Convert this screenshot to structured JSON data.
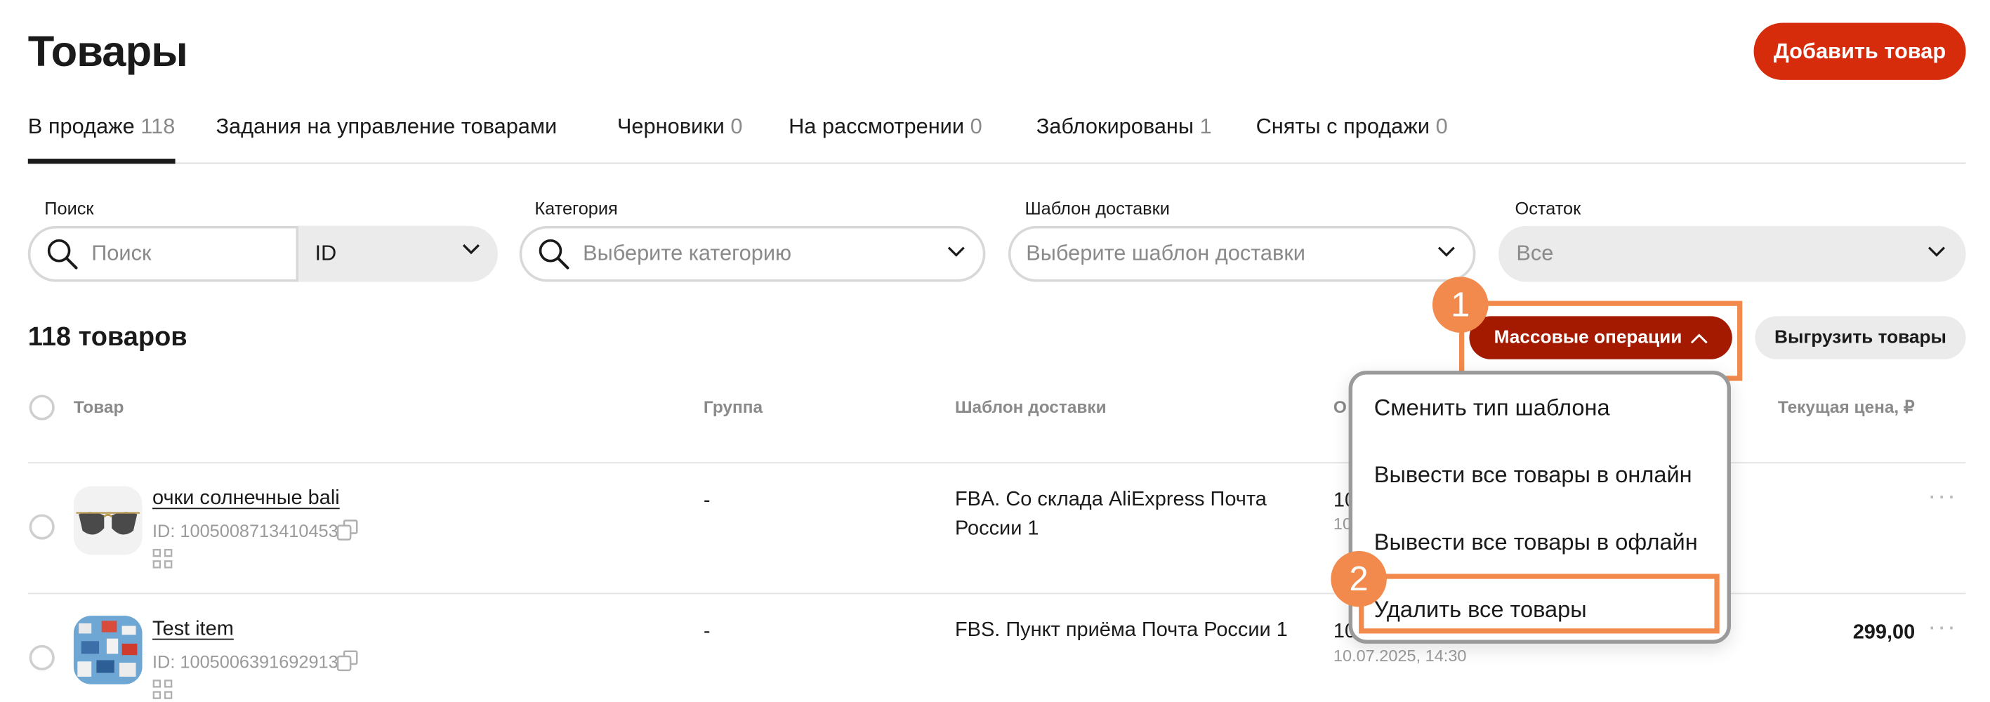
{
  "page": {
    "title": "Товары",
    "add_button": "Добавить товар"
  },
  "tabs": [
    {
      "label": "В продаже",
      "count": "118"
    },
    {
      "label": "Задания на управление товарами",
      "count": ""
    },
    {
      "label": "Черновики",
      "count": "0"
    },
    {
      "label": "На рассмотрении",
      "count": "0"
    },
    {
      "label": "Заблокированы",
      "count": "1"
    },
    {
      "label": "Сняты с продажи",
      "count": "0"
    }
  ],
  "filters": {
    "search": {
      "label": "Поиск",
      "placeholder": "Поиск",
      "type_value": "ID"
    },
    "category": {
      "label": "Категория",
      "placeholder": "Выберите категорию"
    },
    "delivery": {
      "label": "Шаблон доставки",
      "placeholder": "Выберите шаблон доставки"
    },
    "stock": {
      "label": "Остаток",
      "value": "Все"
    }
  },
  "summary": {
    "count_text": "118 товаров"
  },
  "toolbar": {
    "mass_ops": "Массовые операции",
    "export": "Выгрузить товары"
  },
  "table": {
    "headers": {
      "product": "Товар",
      "group": "Группа",
      "delivery": "Шаблон доставки",
      "stock_partial": "О",
      "price": "Текущая цена, ₽"
    },
    "rows": [
      {
        "name": "очки солнечные bali",
        "id": "ID: 1005008713410453",
        "group": "-",
        "delivery": "FBA. Со склада AliExpress Почта России 1",
        "stock_partial": "10",
        "date_partial": "10",
        "price": ""
      },
      {
        "name": "Test item",
        "id": "ID: 1005006391692913",
        "group": "-",
        "delivery": "FBS. Пункт приёма Почта России 1",
        "stock_partial": "10",
        "date": "10.07.2025, 14:30",
        "price": "299,00"
      }
    ]
  },
  "menu": {
    "items": [
      "Сменить тип шаблона",
      "Вывести все товары в онлайн",
      "Вывести все товары в офлайн",
      "Удалить все товары"
    ]
  },
  "callouts": [
    "1",
    "2"
  ],
  "colors": {
    "accent": "#d62c0c",
    "mass_ops_bg": "#a31a00",
    "highlight": "#f28a4d"
  }
}
